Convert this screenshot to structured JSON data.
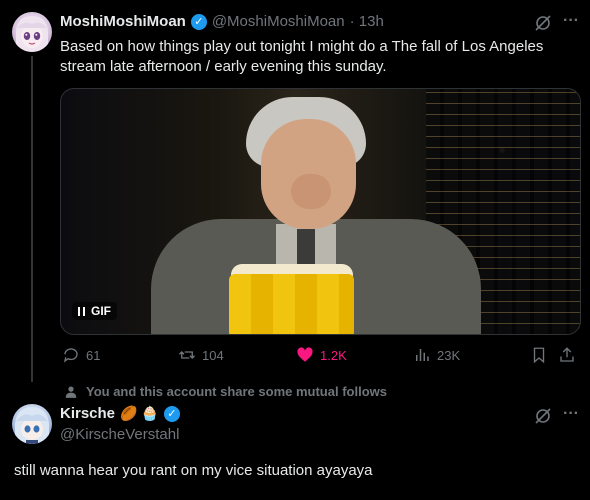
{
  "tweet": {
    "display_name": "MoshiMoshiMoan",
    "handle": "@MoshiMoshiMoan",
    "time": "· 13h",
    "text": "Based on how things play out tonight I might do a The fall of Los Angeles stream late afternoon / early evening this sunday.",
    "gif_label": "GIF",
    "stats": {
      "replies": "61",
      "reposts": "104",
      "likes": "1.2K",
      "views": "23K"
    }
  },
  "mutual_follows_text": "You and this account share some mutual follows",
  "reply": {
    "display_name": "Kirsche",
    "name_emojis": "🏉 🧁",
    "handle": "@KirscheVerstahl",
    "text": "still wanna hear you rant on my vice situation ayayaya"
  },
  "colors": {
    "background": "#000000",
    "text": "#e7e9ea",
    "muted": "#71767b",
    "verified": "#1d9bf0",
    "like": "#f91880"
  }
}
